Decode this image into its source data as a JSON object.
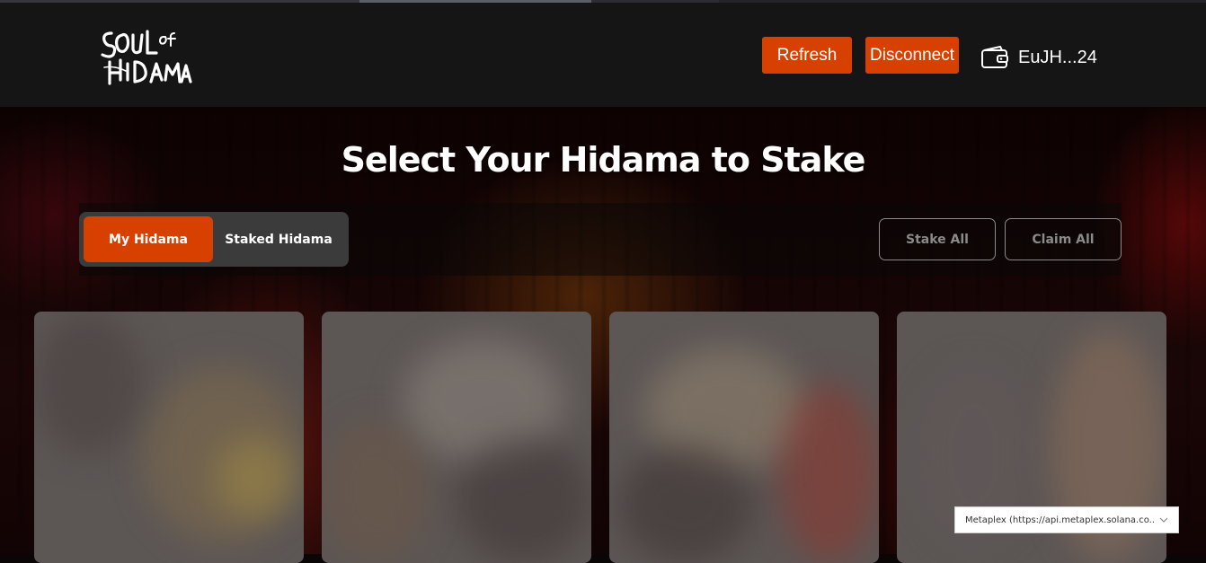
{
  "header": {
    "logo_text": "SOUL OF HIDAMA",
    "refresh_label": "Refresh",
    "disconnect_label": "Disconnect",
    "wallet_icon": "wallet-icon",
    "wallet_address": "EuJH...24"
  },
  "main": {
    "title": "Select Your Hidama to Stake",
    "tabs": [
      {
        "label": "My Hidama",
        "active": true
      },
      {
        "label": "Staked Hidama",
        "active": false
      }
    ],
    "stake_all_label": "Stake All",
    "claim_all_label": "Claim All"
  },
  "rpc_select": {
    "selected": "Metaplex (https://api.metaplex.solana.co...",
    "icon": "chevron-down-icon"
  },
  "colors": {
    "accent": "#d84000",
    "header_bg": "#151515",
    "tab_group_bg": "#3b3b3b"
  }
}
